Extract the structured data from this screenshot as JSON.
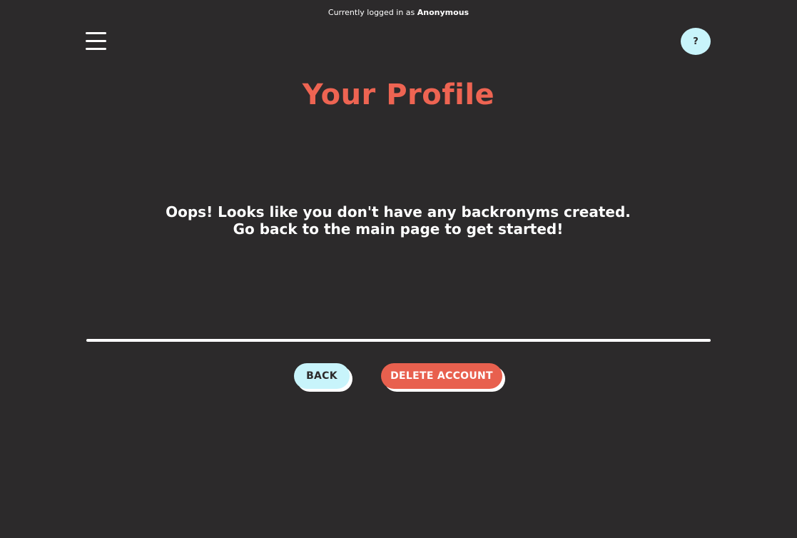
{
  "header": {
    "login_prefix": "Currently logged in as",
    "username": "Anonymous",
    "help_label": "?"
  },
  "main": {
    "title": "Your Profile",
    "empty_message": "Oops! Looks like you don't have any backronyms created. Go back to the main page to get started!"
  },
  "actions": {
    "back_label": "BACK",
    "delete_label": "DELETE ACCOUNT"
  },
  "icons": {
    "menu": "hamburger-menu-icon"
  },
  "colors": {
    "background": "#2c2a2b",
    "accent": "#ee6452",
    "light_button": "#c8f4fb",
    "danger_button": "#e8604e"
  }
}
